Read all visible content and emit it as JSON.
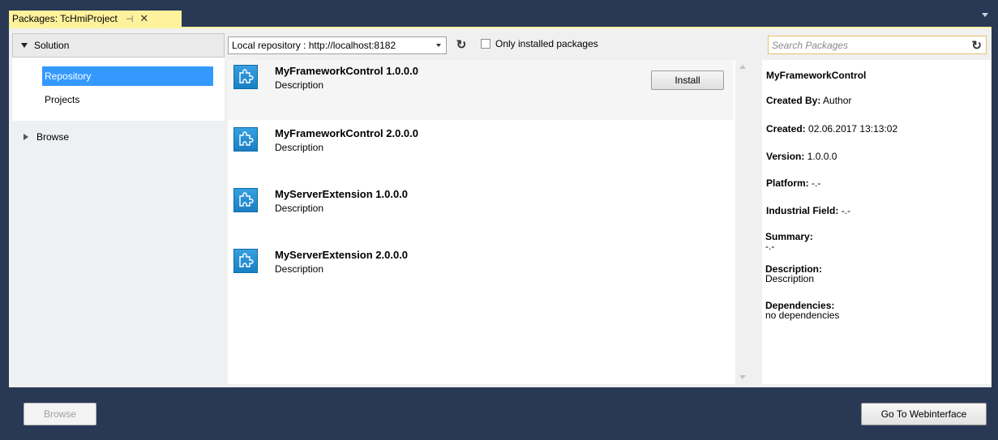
{
  "tab": {
    "title": "Packages: TcHmiProject",
    "pin_icon": "pin-icon",
    "close_icon": "close-icon"
  },
  "sidebar": {
    "solution_label": "Solution",
    "items": [
      {
        "label": "Repository",
        "selected": true
      },
      {
        "label": "Projects",
        "selected": false
      }
    ],
    "browse_label": "Browse"
  },
  "toolbar": {
    "repository_value": "Local repository : http://localhost:8182",
    "refresh_icon": "refresh-icon",
    "only_installed_label": "Only installed packages",
    "only_installed_checked": false
  },
  "packages": [
    {
      "name": "MyFrameworkControl 1.0.0.0",
      "description": "Description",
      "selected": true,
      "action": "Install"
    },
    {
      "name": "MyFrameworkControl 2.0.0.0",
      "description": "Description",
      "selected": false
    },
    {
      "name": "MyServerExtension 1.0.0.0",
      "description": "Description",
      "selected": false
    },
    {
      "name": "MyServerExtension 2.0.0.0",
      "description": "Description",
      "selected": false
    }
  ],
  "search": {
    "placeholder": "Search Packages",
    "value": ""
  },
  "detail": {
    "name": "MyFrameworkControl",
    "created_by_label": "Created By:",
    "created_by": "Author",
    "created_label": "Created:",
    "created": "02.06.2017 13:13:02",
    "version_label": "Version:",
    "version": "1.0.0.0",
    "platform_label": "Platform:",
    "platform": "-.-",
    "industrial_label": "Industrial Field:",
    "industrial": "-.-",
    "summary_label": "Summary:",
    "summary": "-.-",
    "description_label": "Description:",
    "description": "Description",
    "dependencies_label": "Dependencies:",
    "dependencies": "no dependencies"
  },
  "footer": {
    "browse_label": "Browse",
    "webinterface_label": "Go To Webinterface"
  },
  "colors": {
    "chrome": "#293955",
    "tab": "#fff29d",
    "selection": "#3399ff"
  }
}
